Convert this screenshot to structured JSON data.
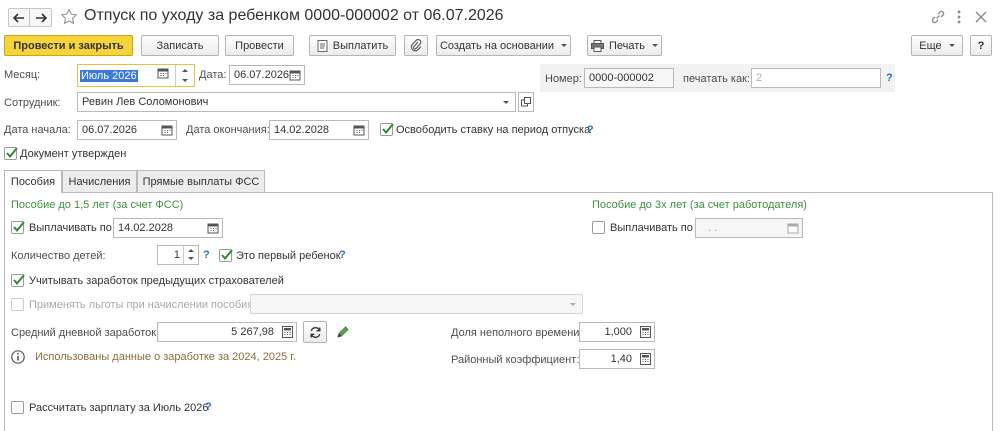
{
  "window": {
    "title": "Отпуск по уходу за ребенком 0000-000002 от 06.07.2026"
  },
  "toolbar": {
    "post_and_close": "Провести и закрыть",
    "save": "Записать",
    "post": "Провести",
    "pay": "Выплатить",
    "create_based_on": "Создать на основании",
    "print": "Печать",
    "more": "Еще",
    "help": "?"
  },
  "header": {
    "month_label": "Месяц:",
    "month_value": "Июль 2026",
    "date_label": "Дата:",
    "date_value": "06.07.2026",
    "number_label": "Номер:",
    "number_value": "0000-000002",
    "print_as_label": "печатать как:",
    "print_as_value": "2",
    "employee_label": "Сотрудник:",
    "employee_value": "Ревин Лев Соломонович",
    "start_label": "Дата начала:",
    "start_value": "06.07.2026",
    "end_label": "Дата окончания:",
    "end_value": "14.02.2028",
    "release_rate_label": "Освободить ставку на период отпуска",
    "release_rate_checked": true,
    "approved_label": "Документ утвержден",
    "approved_checked": true,
    "help": "?"
  },
  "tabs": [
    {
      "label": "Пособия",
      "active": true
    },
    {
      "label": "Начисления",
      "active": false
    },
    {
      "label": "Прямые выплаты ФСС",
      "active": false
    }
  ],
  "benefits": {
    "section_15_title": "Пособие до 1,5 лет (за счет ФСС)",
    "section_3_title": "Пособие до 3х лет (за счет работодателя)",
    "pay_until_label": "Выплачивать по",
    "pay_until_value": "14.02.2028",
    "pay_until_checked": true,
    "pay_until_3_label": "Выплачивать по",
    "pay_until_3_value": ". .",
    "pay_until_3_checked": false,
    "children_label": "Количество детей:",
    "children_value": "1",
    "first_child_label": "Это первый ребенок",
    "first_child_checked": true,
    "prev_insurers_label": "Учитывать заработок предыдущих страхователей",
    "prev_insurers_checked": true,
    "privileges_label": "Применять льготы при начислении пособия",
    "privileges_checked": false,
    "avg_earnings_label": "Средний дневной заработок:",
    "avg_earnings_value": "5 267,98",
    "info_text": "Использованы данные о заработке за  2024,  2025 г.",
    "parttime_label": "Доля неполного времени:",
    "parttime_value": "1,000",
    "district_label": "Районный коэффициент:",
    "district_value": "1,40",
    "calc_salary_label": "Рассчитать зарплату за Июль 2026",
    "calc_salary_checked": false
  }
}
